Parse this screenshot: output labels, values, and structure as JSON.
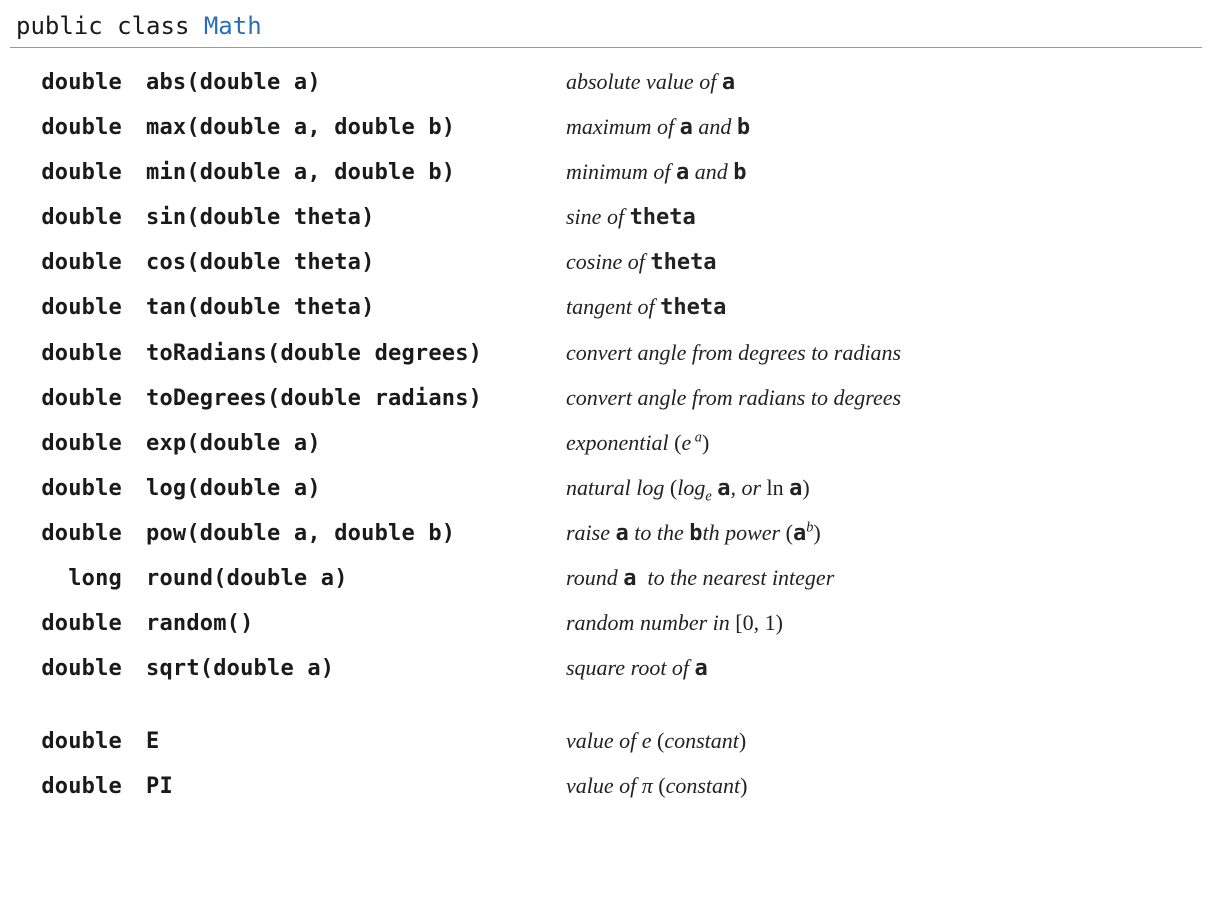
{
  "header": {
    "prefix": "public class ",
    "classname": "Math"
  },
  "methods": [
    {
      "ret": "double",
      "sig": "abs(double a)",
      "desc_html": "absolute value of <span class='mono-in'>a</span>"
    },
    {
      "ret": "double",
      "sig": "max(double a, double b)",
      "desc_html": "maximum of <span class='mono-in'>a</span> and <span class='mono-in'>b</span>"
    },
    {
      "ret": "double",
      "sig": "min(double a, double b)",
      "desc_html": "minimum of <span class='mono-in'>a</span> and <span class='mono-in'>b</span>"
    },
    {
      "ret": "double",
      "sig": "sin(double theta)",
      "desc_html": "sine of <span class='mono-in'>theta</span>"
    },
    {
      "ret": "double",
      "sig": "cos(double theta)",
      "desc_html": "cosine of <span class='mono-in'>theta</span>"
    },
    {
      "ret": "double",
      "sig": "tan(double theta)",
      "desc_html": "tangent of <span class='mono-in'>theta</span>"
    },
    {
      "ret": "double",
      "sig": "toRadians(double degrees)",
      "desc_html": "convert angle from degrees to radians"
    },
    {
      "ret": "double",
      "sig": "toDegrees(double radians)",
      "desc_html": "convert angle from radians to degrees"
    },
    {
      "ret": "double",
      "sig": "exp(double a)",
      "desc_html": "exponential <span class='serif-in'>(</span>e<sup>&nbsp;a</sup><span class='serif-in'>)</span>"
    },
    {
      "ret": "double",
      "sig": "log(double a)",
      "desc_html": "natural log <span class='serif-in'>(</span>log<sub>e</sub> <span class='mono-in'>a</span>, or <span class='serif-in'>ln</span> <span class='mono-in'>a</span><span class='serif-in'>)</span>"
    },
    {
      "ret": "double",
      "sig": "pow(double a, double b)",
      "desc_html": "raise <span class='mono-in'>a</span> to the <span class='mono-in'>b</span>th power <span class='serif-in'>(</span><span class='mono-in'>a</span><sup>b</sup><span class='serif-in'>)</span>"
    },
    {
      "ret": "long",
      "sig": "round(double a)",
      "desc_html": "round <span class='mono-in'>a</span>&nbsp; to the nearest integer"
    },
    {
      "ret": "double",
      "sig": "random()",
      "desc_html": "random number in <span class='serif-in'>[0, 1)</span>"
    },
    {
      "ret": "double",
      "sig": "sqrt(double a)",
      "desc_html": "square root of <span class='mono-in'>a</span>"
    }
  ],
  "constants": [
    {
      "ret": "double",
      "sig": "E",
      "desc_html": "value of e <span class='serif-in'>(</span>constant<span class='serif-in'>)</span>"
    },
    {
      "ret": "double",
      "sig": "PI",
      "desc_html": "value of &pi; <span class='serif-in'>(</span>constant<span class='serif-in'>)</span>"
    }
  ]
}
